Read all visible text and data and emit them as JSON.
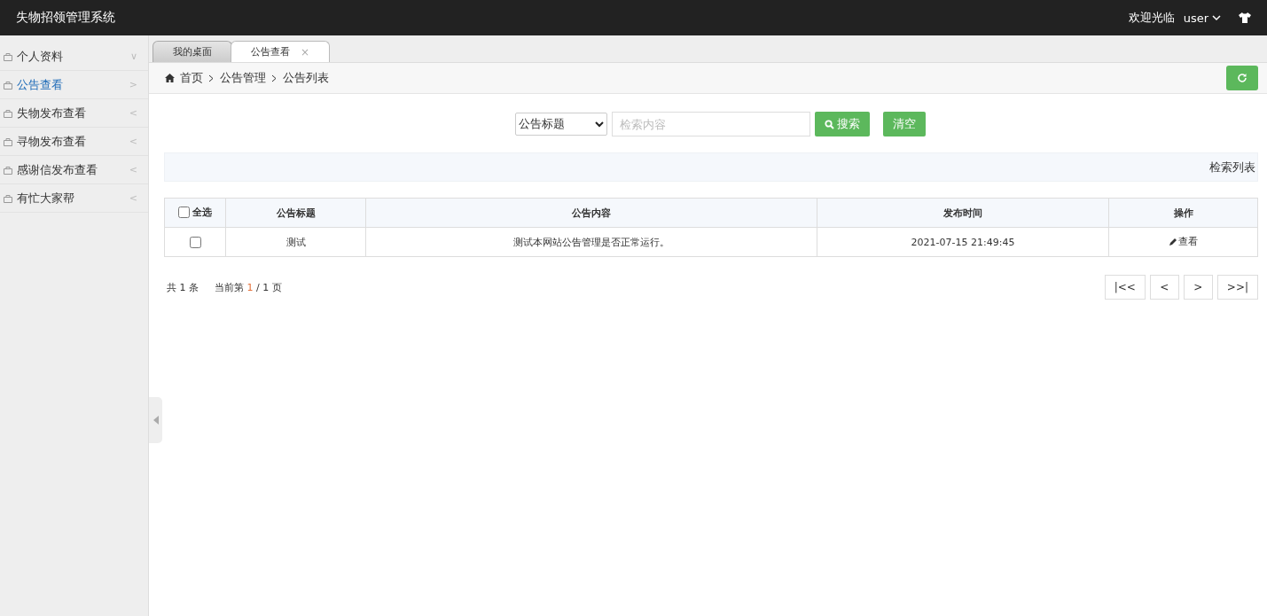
{
  "header": {
    "title": "失物招领管理系统",
    "welcome": "欢迎光临",
    "user": "user"
  },
  "sidebar": {
    "items": [
      {
        "label": "个人资料",
        "selected": false,
        "chevron": "∨"
      },
      {
        "label": "公告查看",
        "selected": true,
        "chevron": ">"
      },
      {
        "label": "失物发布查看",
        "selected": false,
        "chevron": "<"
      },
      {
        "label": "寻物发布查看",
        "selected": false,
        "chevron": "<"
      },
      {
        "label": "感谢信发布查看",
        "selected": false,
        "chevron": "<"
      },
      {
        "label": "有忙大家帮",
        "selected": false,
        "chevron": "<"
      }
    ]
  },
  "tabs": [
    {
      "label": "我的桌面",
      "selected": false
    },
    {
      "label": "公告查看",
      "selected": true,
      "close": "×"
    }
  ],
  "breadcrumb": [
    "首页",
    "公告管理",
    "公告列表"
  ],
  "search": {
    "select": "公告标题",
    "placeholder": "检索内容",
    "search_button": "搜索",
    "clear_button": "清空"
  },
  "panel_title": "检索列表",
  "table": {
    "select_all": {
      "label": "全选",
      "checked": false
    },
    "columns": [
      "公告标题",
      "公告内容",
      "发布时间",
      "操作"
    ],
    "rows": [
      {
        "checked": false,
        "title": "测试",
        "content": "测试本网站公告管理是否正常运行。",
        "time": "2021-07-15 21:49:45",
        "action": "查看"
      }
    ]
  },
  "pagination": {
    "total": "共 1 条",
    "prefix": "当前第",
    "current": "1",
    "suffix": "/ 1 页",
    "buttons": [
      "|<<",
      "<",
      ">",
      ">>|"
    ]
  }
}
